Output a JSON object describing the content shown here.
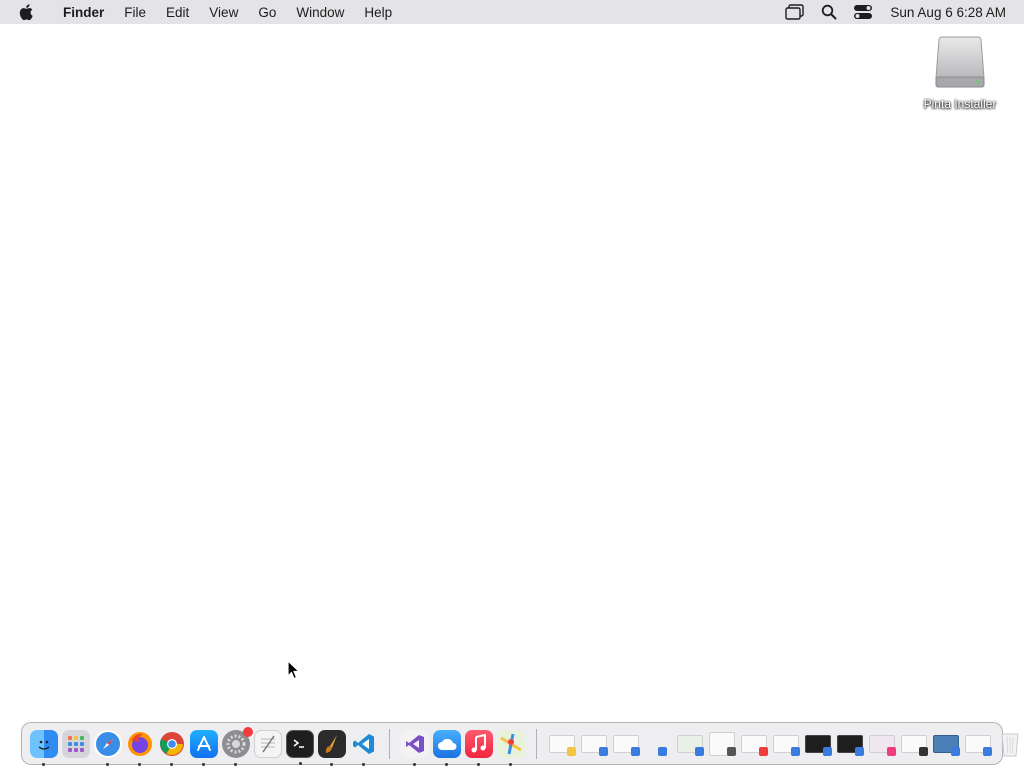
{
  "menubar": {
    "app_name": "Finder",
    "items": [
      "File",
      "Edit",
      "View",
      "Go",
      "Window",
      "Help"
    ],
    "clock": "Sun Aug 6  6:28 AM",
    "status_icons": [
      "display-icon",
      "search-icon",
      "control-center-icon"
    ]
  },
  "desktop": {
    "icons": [
      {
        "label": "Pinta Installer",
        "icon": "external-drive-icon"
      }
    ]
  },
  "dock": {
    "apps": [
      {
        "name": "finder-icon",
        "running": true,
        "color": "#2f8cf0"
      },
      {
        "name": "launchpad-icon",
        "running": false,
        "color": "#8a8a8f"
      },
      {
        "name": "safari-icon",
        "running": true,
        "color": "#2e7de9"
      },
      {
        "name": "firefox-icon",
        "running": true,
        "color": "#e8562a"
      },
      {
        "name": "chrome-icon",
        "running": true,
        "color": "#34a853"
      },
      {
        "name": "app-store-icon",
        "running": true,
        "color": "#1c8cf5"
      },
      {
        "name": "system-settings-icon",
        "running": true,
        "color": "#6e6e73"
      },
      {
        "name": "textedit-icon",
        "running": false,
        "color": "#d9d9d9"
      },
      {
        "name": "terminal-icon",
        "running": true,
        "color": "#1e1e1e"
      },
      {
        "name": "pinta-icon",
        "running": true,
        "color": "#2b2b2b"
      },
      {
        "name": "vscode-icon",
        "running": true,
        "color": "#1f8ad6"
      }
    ],
    "recents": [
      {
        "name": "visual-studio-icon",
        "running": true,
        "color": "#7a4fc7"
      },
      {
        "name": "cloud-app-icon",
        "running": true,
        "color": "#2f8fe8"
      },
      {
        "name": "music-icon",
        "running": true,
        "color": "#f23c4f"
      },
      {
        "name": "maps-icon",
        "running": true,
        "color": "#5fb84a"
      }
    ],
    "documents": [
      "light",
      "light",
      "light",
      "none",
      "light",
      "light",
      "light",
      "light",
      "dark",
      "dark",
      "light",
      "light",
      "blue",
      "light",
      "trash"
    ]
  }
}
